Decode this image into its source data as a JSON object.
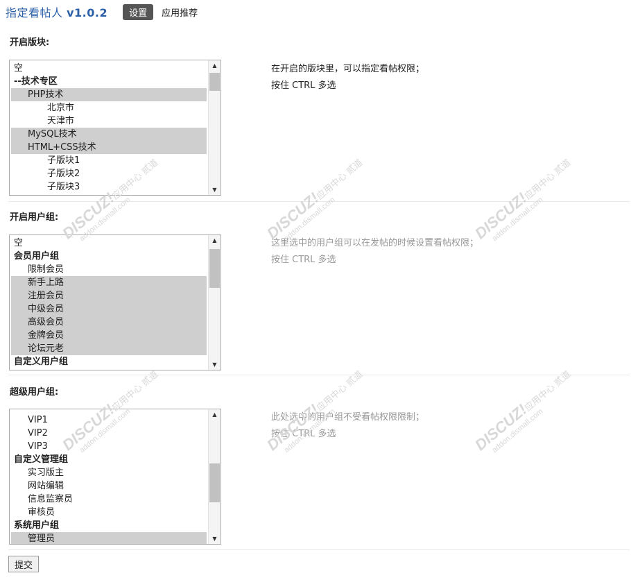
{
  "header": {
    "title": "指定看帖人",
    "version": "v1.0.2",
    "tabs": [
      {
        "label": "设置",
        "active": true
      },
      {
        "label": "应用推荐",
        "active": false
      }
    ]
  },
  "sections": [
    {
      "label": "开启版块:",
      "options": [
        {
          "text": "空",
          "selected": false
        },
        {
          "text": "--技术专区",
          "selected": false
        },
        {
          "text": "PHP技术",
          "selected": true
        },
        {
          "text": "北京市",
          "selected": false
        },
        {
          "text": "天津市",
          "selected": false
        },
        {
          "text": "MySQL技术",
          "selected": true
        },
        {
          "text": "HTML+CSS技术",
          "selected": true
        },
        {
          "text": "子版块1",
          "selected": false
        },
        {
          "text": "子版块2",
          "selected": false
        },
        {
          "text": "子版块3",
          "selected": false
        }
      ],
      "desc_lines": [
        "在开启的版块里，可以指定看帖权限；",
        "按住 CTRL 多选"
      ]
    },
    {
      "label": "开启用户组:",
      "options": [
        {
          "text": "空",
          "selected": false
        },
        {
          "text": "会员用户组",
          "selected": false
        },
        {
          "text": "限制会员",
          "selected": false
        },
        {
          "text": "新手上路",
          "selected": true
        },
        {
          "text": "注册会员",
          "selected": true
        },
        {
          "text": "中级会员",
          "selected": true
        },
        {
          "text": "高级会员",
          "selected": true
        },
        {
          "text": "金牌会员",
          "selected": true
        },
        {
          "text": "论坛元老",
          "selected": true
        },
        {
          "text": "自定义用户组",
          "selected": false
        }
      ],
      "desc_lines": [
        "这里选中的用户组可以在发帖的时候设置看帖权限；",
        "按住 CTRL 多选"
      ]
    },
    {
      "label": "超级用户组:",
      "options": [
        {
          "text": "VIP1",
          "selected": false
        },
        {
          "text": "VIP2",
          "selected": false
        },
        {
          "text": "VIP3",
          "selected": false
        },
        {
          "text": "自定义管理组",
          "selected": false
        },
        {
          "text": "实习版主",
          "selected": false
        },
        {
          "text": "网站编辑",
          "selected": false
        },
        {
          "text": "信息监察员",
          "selected": false
        },
        {
          "text": "审核员",
          "selected": false
        },
        {
          "text": "系统用户组",
          "selected": false
        },
        {
          "text": "管理员",
          "selected": true
        }
      ],
      "desc_lines": [
        "此处选中的用户组不受看帖权限限制；",
        "按住 CTRL 多选"
      ]
    }
  ],
  "submit_label": "提交",
  "watermark": {
    "brand": "DISCUZ!",
    "cn": "应用中心",
    "site": "addon.dismall.com",
    "tag": "贰道"
  }
}
